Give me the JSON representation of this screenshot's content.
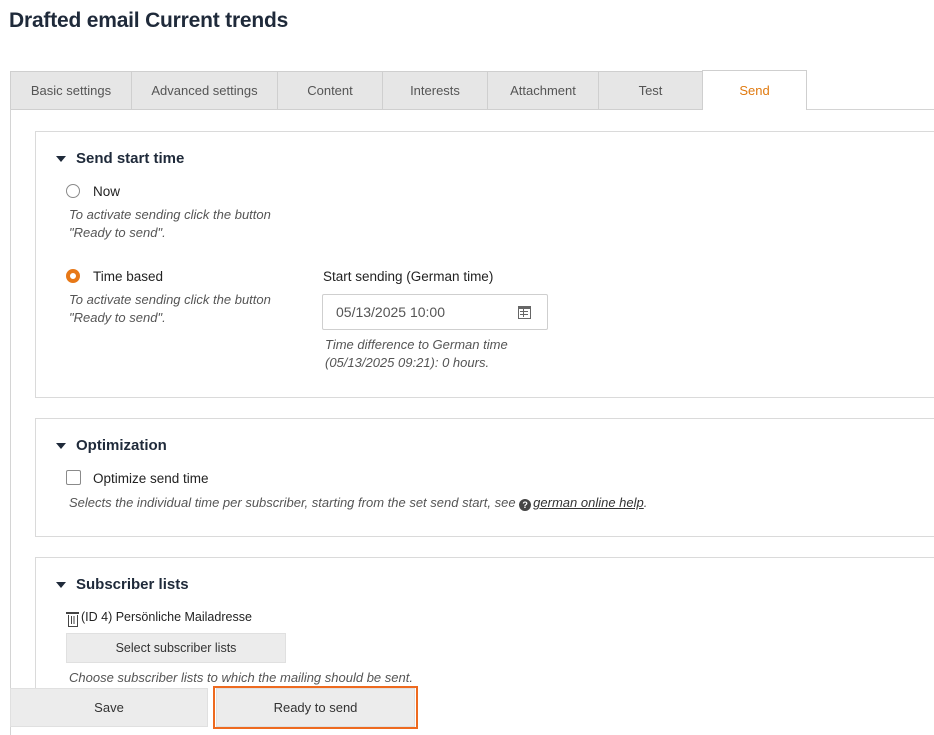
{
  "page": {
    "title": "Drafted email Current trends"
  },
  "tabs": [
    {
      "label": "Basic settings"
    },
    {
      "label": "Advanced settings"
    },
    {
      "label": "Content"
    },
    {
      "label": "Interests"
    },
    {
      "label": "Attachment"
    },
    {
      "label": "Test"
    },
    {
      "label": "Send",
      "active": true
    }
  ],
  "send_start": {
    "title": "Send start time",
    "now": {
      "label": "Now",
      "hint_line1": "To activate sending click the button",
      "hint_line2": "\"Ready to send\".",
      "checked": false
    },
    "time_based": {
      "label": "Time based",
      "hint_line1": "To activate sending click the button",
      "hint_line2": "\"Ready to send\".",
      "checked": true
    },
    "start_label": "Start sending (German time)",
    "start_value": "05/13/2025 10:00",
    "diff_line1": "Time difference to German time",
    "diff_line2": "(05/13/2025 09:21): 0 hours."
  },
  "optimization": {
    "title": "Optimization",
    "checkbox_label": "Optimize send time",
    "checked": false,
    "hint": "Selects the individual time per subscriber, starting from the set send start, see ",
    "help_icon": "?",
    "help_link": "german online help",
    "hint_end": "."
  },
  "subscriber_lists": {
    "title": "Subscriber lists",
    "items": [
      {
        "label": "(ID 4) Persönliche Mailadresse"
      }
    ],
    "select_button": "Select subscriber lists",
    "hint": "Choose subscriber lists to which the mailing should be sent."
  },
  "footer": {
    "save": "Save",
    "ready": "Ready to send"
  },
  "colors": {
    "accent": "#e77817",
    "highlight": "#ee6a1f"
  }
}
